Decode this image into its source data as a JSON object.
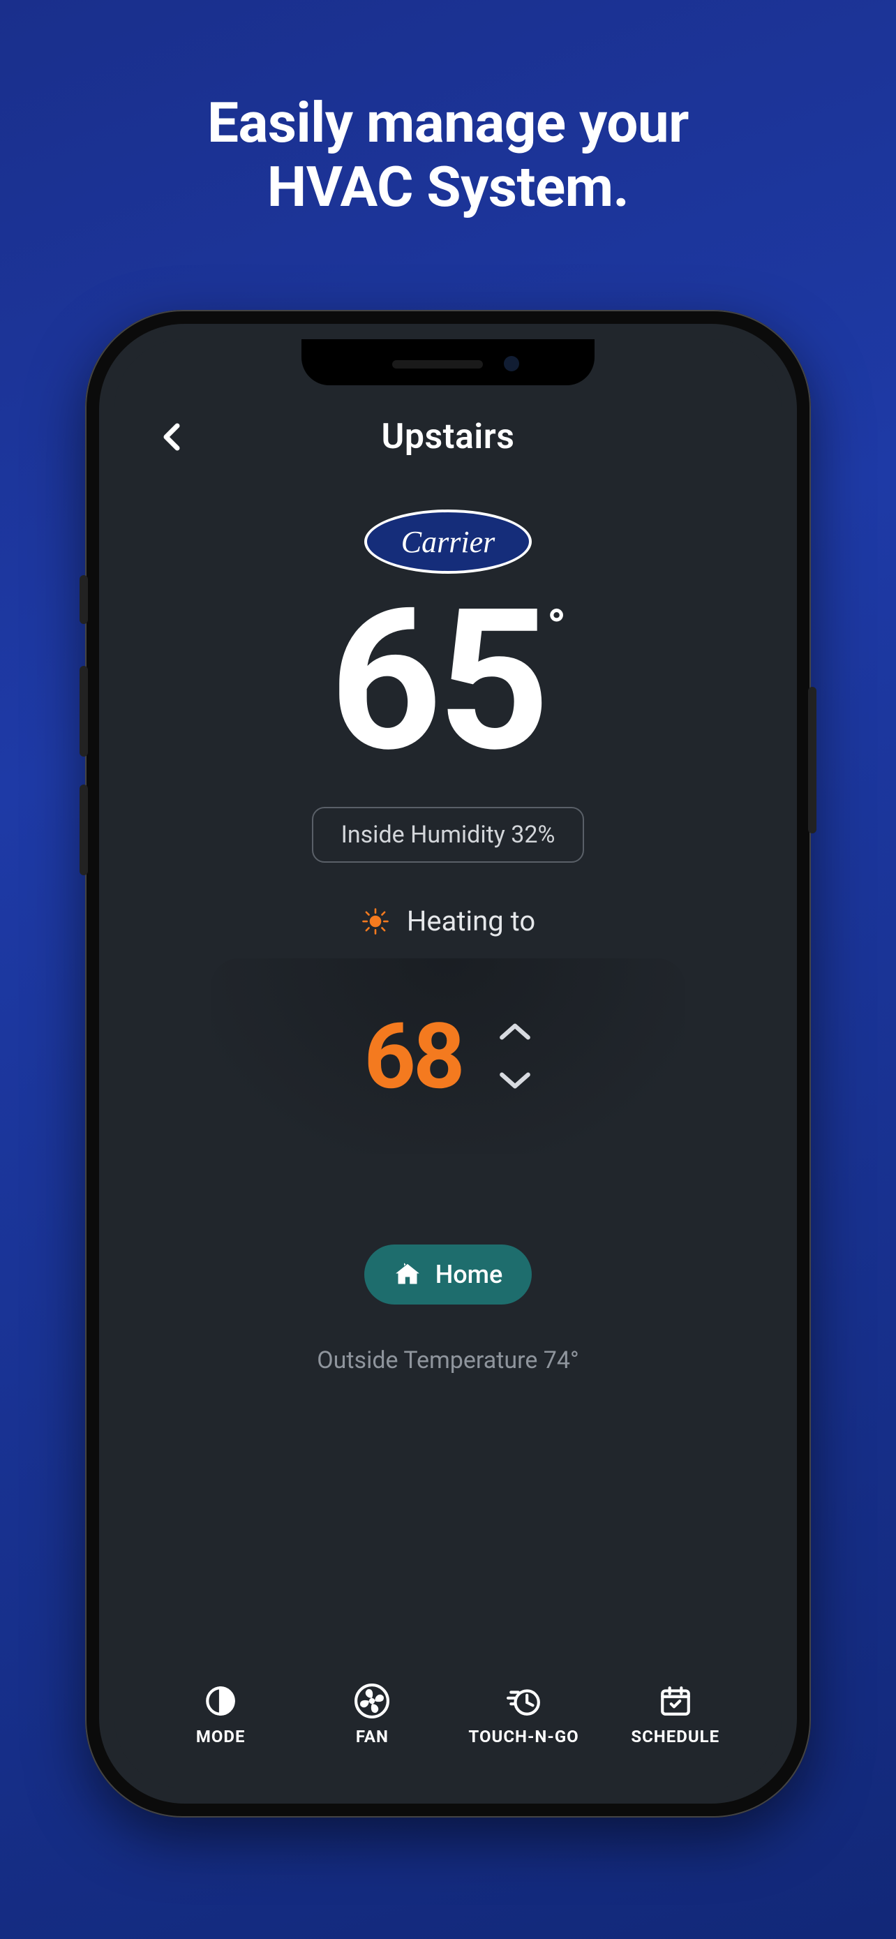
{
  "marketing": {
    "headline_line1": "Easily manage your",
    "headline_line2": "HVAC System."
  },
  "header": {
    "zone_name": "Upstairs"
  },
  "brand": {
    "name": "Carrier"
  },
  "current": {
    "temperature": "65",
    "degree_symbol": "°",
    "humidity_label": "Inside Humidity 32%"
  },
  "mode": {
    "status_text": "Heating to",
    "setpoint": "68",
    "accent_color": "#f47a1f"
  },
  "presence": {
    "button_label": "Home"
  },
  "outside": {
    "line": "Outside Temperature 74°"
  },
  "nav": {
    "items": [
      {
        "label": "MODE"
      },
      {
        "label": "FAN"
      },
      {
        "label": "TOUCH-N-GO"
      },
      {
        "label": "SCHEDULE"
      }
    ]
  }
}
